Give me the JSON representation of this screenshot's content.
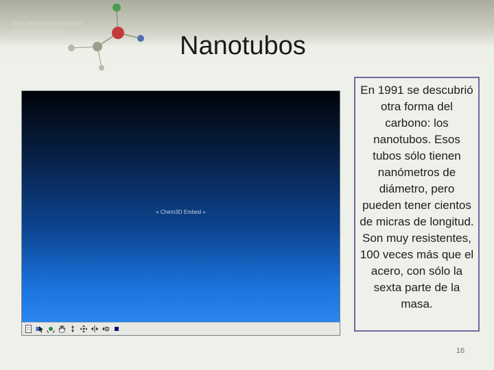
{
  "slide": {
    "title": "Nanotubos",
    "number": "16"
  },
  "decoration": {
    "binary_line_1": "010101010101010101",
    "binary_line_2": "0101010101010"
  },
  "embed": {
    "label": "« Chem3D Embed »",
    "toolbar_icons": [
      "page-icon",
      "select-icon",
      "rotate-icon",
      "hand-icon",
      "zoom-icon",
      "move-icon",
      "translate-icon",
      "flip-icon",
      "stop-icon"
    ]
  },
  "text_box": {
    "content": "En 1991 se descubrió otra forma del carbono: los nanotubos. Esos tubos sólo tienen nanómetros de diámetro, pero pueden tener cientos de micras de longitud. Son muy resistentes, 100 veces más que el acero, con sólo la sexta parte de la masa."
  },
  "colors": {
    "text_box_border": "#74659e",
    "viewport_top": "#010309",
    "viewport_bottom": "#2a86ee"
  }
}
